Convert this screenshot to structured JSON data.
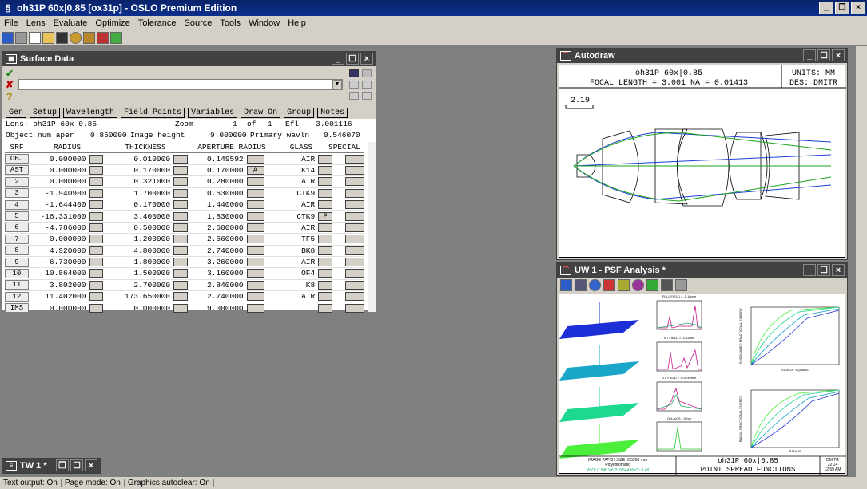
{
  "app": {
    "title": "oh31P 60x|0.85 [ox31p] - OSLO Premium Edition"
  },
  "menu": [
    "File",
    "Lens",
    "Evaluate",
    "Optimize",
    "Tolerance",
    "Source",
    "Tools",
    "Window",
    "Help"
  ],
  "surface_data": {
    "title": "Surface Data",
    "tabs": [
      "Gen",
      "Setup",
      "Wavelength",
      "Field Points",
      "Variables",
      "Draw On",
      "Group",
      "Notes"
    ],
    "lens_label": "Lens: oh31P 60x 0.85",
    "zoom_label": "Zoom",
    "zoom_value": "1",
    "zoom_of": "of",
    "zoom_total": "1",
    "efl_label": "Efl",
    "efl_value": "3.001116",
    "obj_aper_label": "Object num aper",
    "obj_aper_value": "0.850000",
    "image_height_label": "Image height",
    "image_height_value": "9.000000",
    "primary_wavln_label": "Primary wavln",
    "primary_wavln_value": "0.546070",
    "headers": [
      "SRF",
      "RADIUS",
      "THICKNESS",
      "APERTURE RADIUS",
      "GLASS",
      "SPECIAL"
    ],
    "rows": [
      {
        "srf": "OBJ",
        "radius": "0.000000",
        "thickness": "0.010000",
        "aperture": "0.149592",
        "aflag": "",
        "glass": "AIR",
        "gflag": ""
      },
      {
        "srf": "AST",
        "radius": "0.000000",
        "thickness": "0.170000",
        "aperture": "0.170000",
        "aflag": "A",
        "glass": "K14",
        "gflag": ""
      },
      {
        "srf": "2",
        "radius": "0.000000",
        "thickness": "0.321000",
        "aperture": "0.280000",
        "aflag": "",
        "glass": "AIR",
        "gflag": ""
      },
      {
        "srf": "3",
        "radius": "-1.940900",
        "thickness": "1.700000",
        "aperture": "0.630000",
        "aflag": "",
        "glass": "CTK9",
        "gflag": ""
      },
      {
        "srf": "4",
        "radius": "-1.644400",
        "thickness": "0.170000",
        "aperture": "1.440000",
        "aflag": "",
        "glass": "AIR",
        "gflag": ""
      },
      {
        "srf": "5",
        "radius": "-16.331000",
        "thickness": "3.400000",
        "aperture": "1.830000",
        "aflag": "",
        "glass": "CTK9",
        "gflag": "P"
      },
      {
        "srf": "6",
        "radius": "-4.786000",
        "thickness": "0.500000",
        "aperture": "2.600000",
        "aflag": "",
        "glass": "AIR",
        "gflag": ""
      },
      {
        "srf": "7",
        "radius": "0.000000",
        "thickness": "1.200000",
        "aperture": "2.660000",
        "aflag": "",
        "glass": "TF5",
        "gflag": ""
      },
      {
        "srf": "8",
        "radius": "4.920000",
        "thickness": "4.800000",
        "aperture": "2.740000",
        "aflag": "",
        "glass": "BK8",
        "gflag": ""
      },
      {
        "srf": "9",
        "radius": "-6.730000",
        "thickness": "1.800000",
        "aperture": "3.260000",
        "aflag": "",
        "glass": "AIR",
        "gflag": ""
      },
      {
        "srf": "10",
        "radius": "10.864000",
        "thickness": "1.500000",
        "aperture": "3.160000",
        "aflag": "",
        "glass": "OF4",
        "gflag": ""
      },
      {
        "srf": "11",
        "radius": "3.802000",
        "thickness": "2.700000",
        "aperture": "2.840000",
        "aflag": "",
        "glass": "K8",
        "gflag": ""
      },
      {
        "srf": "12",
        "radius": "11.402000",
        "thickness": "173.650000",
        "aperture": "2.740000",
        "aflag": "",
        "glass": "AIR",
        "gflag": ""
      },
      {
        "srf": "IMS",
        "radius": "0.000000",
        "thickness": "0.000000",
        "aperture": "9.000000",
        "aflag": "",
        "glass": "",
        "gflag": ""
      }
    ]
  },
  "autodraw": {
    "title": "Autodraw",
    "lens_name": "oh31P 60x|0.85",
    "focal_line": "FOCAL LENGTH = 3.001   NA = 0.01413",
    "units": "UNITS: MM",
    "des": "DES: DMITR",
    "scale": "2.19"
  },
  "psf": {
    "title": "UW 1 - PSF Analysis *",
    "field_labels": [
      "FULL FIELD = -0.18mm",
      "0.7 FIELD = -0.13mm",
      "0.5 FIELD = -0.0749mm",
      "ON-AXIS = 0mm"
    ],
    "ylabel_top": "ENSQUARED FRACTIONAL ENERGY",
    "xlabel_top": "SIDE OF SQUARE",
    "ylabel_bottom": "RADIAL FRACTIONAL ENERGY",
    "xlabel_bottom": "RADIUS",
    "image_patch": "IMAGE PATCH SIZE: 0.5263 mm",
    "polychromatic": "Polychromatic",
    "wavelengths": "WV1: 0.546  WV2: 0.644  WV3: 0.48",
    "lens_name": "oh31P 60x|0.85",
    "plot_title": "POINT SPREAD FUNCTIONS",
    "designer": "DMITR",
    "date": "22 14",
    "time": "12:59 AM"
  },
  "tw": {
    "title": "TW 1 *"
  },
  "status": {
    "text_output": "Text output: On",
    "page_mode": "Page mode: On",
    "graphics_autoclear": "Graphics autoclear: On"
  },
  "colors": {
    "title_bg": "#0a246a",
    "child_title_bg": "#424242",
    "workspace": "#808080",
    "lens_blue": "#1e3fd6",
    "lens_green": "#1aa31a"
  }
}
